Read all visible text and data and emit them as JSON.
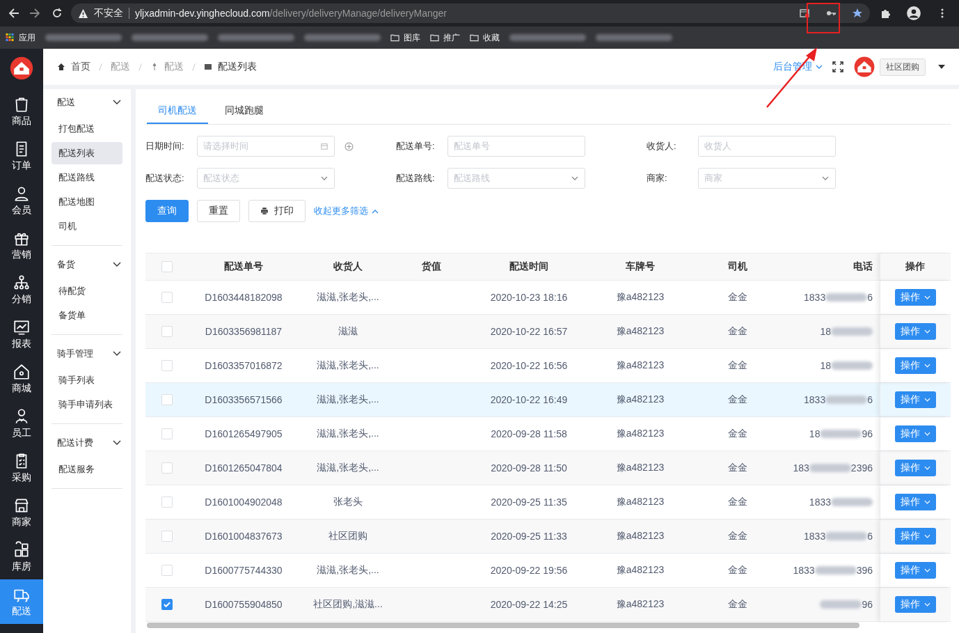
{
  "browser": {
    "security": "不安全",
    "url_host": "yljxadmin-dev.yinghecloud.com",
    "url_path": "/delivery/deliveryManage/deliveryManger",
    "bookmarks": [
      {
        "kind": "apps",
        "label": "应用"
      },
      {
        "kind": "blurred"
      },
      {
        "kind": "blurred"
      },
      {
        "kind": "blurred"
      },
      {
        "kind": "blurred"
      },
      {
        "kind": "folder",
        "label": "图库"
      },
      {
        "kind": "folder",
        "label": "推广"
      },
      {
        "kind": "folder",
        "label": "收藏"
      },
      {
        "kind": "blurred"
      },
      {
        "kind": "blurred"
      }
    ]
  },
  "nav": [
    {
      "label": "商品",
      "selected": false
    },
    {
      "label": "订单",
      "selected": false
    },
    {
      "label": "会员",
      "selected": false
    },
    {
      "label": "营销",
      "selected": false
    },
    {
      "label": "分销",
      "selected": false
    },
    {
      "label": "报表",
      "selected": false
    },
    {
      "label": "商城",
      "selected": false
    },
    {
      "label": "员工",
      "selected": false
    },
    {
      "label": "采购",
      "selected": false
    },
    {
      "label": "商家",
      "selected": false
    },
    {
      "label": "库房",
      "selected": false
    },
    {
      "label": "配送",
      "selected": true
    }
  ],
  "breadcrumb": [
    "首页",
    "配送",
    "配送",
    "配送列表"
  ],
  "header": {
    "admin": "后台管理",
    "shop": "社区团购"
  },
  "submenu": [
    {
      "title": "配送",
      "expanded": true,
      "items": [
        {
          "label": "打包配送",
          "selected": false
        },
        {
          "label": "配送列表",
          "selected": true
        },
        {
          "label": "配送路线",
          "selected": false
        },
        {
          "label": "配送地图",
          "selected": false
        },
        {
          "label": "司机",
          "selected": false
        }
      ]
    },
    {
      "title": "备货",
      "expanded": true,
      "items": [
        {
          "label": "待配货",
          "selected": false
        },
        {
          "label": "备货单",
          "selected": false
        }
      ]
    },
    {
      "title": "骑手管理",
      "expanded": true,
      "items": [
        {
          "label": "骑手列表",
          "selected": false
        },
        {
          "label": "骑手申请列表",
          "selected": false
        }
      ]
    },
    {
      "title": "配送计费",
      "expanded": true,
      "items": [
        {
          "label": "配送服务",
          "selected": false
        }
      ]
    }
  ],
  "tabs": [
    {
      "label": "司机配送",
      "selected": true
    },
    {
      "label": "同城跑腿",
      "selected": false
    }
  ],
  "filters": [
    {
      "label": "日期时间:",
      "placeholder": "请选择时间",
      "kind": "date"
    },
    {
      "label": "配送单号:",
      "placeholder": "配送单号",
      "kind": "text"
    },
    {
      "label": "收货人:",
      "placeholder": "收货人",
      "kind": "text"
    },
    {
      "label": "配送状态:",
      "placeholder": "配送状态",
      "kind": "select"
    },
    {
      "label": "配送路线:",
      "placeholder": "配送路线",
      "kind": "select"
    },
    {
      "label": "商家:",
      "placeholder": "商家",
      "kind": "select"
    }
  ],
  "buttons": {
    "query": "查询",
    "reset": "重置",
    "print": "打印",
    "collapse": "收起更多筛选"
  },
  "table": {
    "all_checked": false,
    "columns": [
      "配送单号",
      "收货人",
      "货值",
      "配送时间",
      "车牌号",
      "司机",
      "电话",
      "操作"
    ],
    "rows": [
      {
        "checked": false,
        "highlighted": false,
        "id": "D1603448182098",
        "consignee": "滋滋,张老头,...",
        "time": "2020-10-23 18:16",
        "plate": "豫a482123",
        "driver": "金金",
        "phone_start": "1833",
        "phone_end": "6",
        "action": "操作"
      },
      {
        "checked": false,
        "highlighted": false,
        "id": "D1603356981187",
        "consignee": "滋滋",
        "time": "2020-10-22 16:57",
        "plate": "豫a482123",
        "driver": "金金",
        "phone_start": "18",
        "action": "操作"
      },
      {
        "checked": false,
        "highlighted": false,
        "id": "D1603357016872",
        "consignee": "滋滋,张老头,...",
        "time": "2020-10-22 16:56",
        "plate": "豫a482123",
        "driver": "金金",
        "phone_start": "18",
        "action": "操作"
      },
      {
        "checked": false,
        "highlighted": true,
        "id": "D1603356571566",
        "consignee": "滋滋,张老头,...",
        "time": "2020-10-22 16:49",
        "plate": "豫a482123",
        "driver": "金金",
        "phone_start": "1833",
        "phone_end": "6",
        "action": "操作"
      },
      {
        "checked": false,
        "highlighted": false,
        "id": "D1601265497905",
        "consignee": "滋滋,张老头,...",
        "time": "2020-09-28 11:58",
        "plate": "豫a482123",
        "driver": "金金",
        "phone_start": "18",
        "phone_end": "96",
        "action": "操作"
      },
      {
        "checked": false,
        "highlighted": false,
        "id": "D1601265047804",
        "consignee": "滋滋,张老头,...",
        "time": "2020-09-28 11:50",
        "plate": "豫a482123",
        "driver": "金金",
        "phone_start": "183",
        "phone_end": "2396",
        "action": "操作"
      },
      {
        "checked": false,
        "highlighted": false,
        "id": "D1601004902048",
        "consignee": "张老头",
        "time": "2020-09-25 11:35",
        "plate": "豫a482123",
        "driver": "金金",
        "phone_start": "1833",
        "action": "操作"
      },
      {
        "checked": false,
        "highlighted": false,
        "id": "D1601004837673",
        "consignee": "社区团购",
        "time": "2020-09-25 11:33",
        "plate": "豫a482123",
        "driver": "金金",
        "phone_start": "1833",
        "phone_end": "6",
        "action": "操作"
      },
      {
        "checked": false,
        "highlighted": false,
        "id": "D1600775744330",
        "consignee": "滋滋,张老头,...",
        "time": "2020-09-22 19:56",
        "plate": "豫a482123",
        "driver": "金金",
        "phone_start": "1833",
        "phone_end": "396",
        "action": "操作"
      },
      {
        "checked": true,
        "highlighted": false,
        "id": "D1600755904850",
        "consignee": "社区团购,滋滋...",
        "time": "2020-09-22 14:25",
        "plate": "豫a482123",
        "driver": "金金",
        "phone_end": "96",
        "action": "操作"
      }
    ]
  }
}
